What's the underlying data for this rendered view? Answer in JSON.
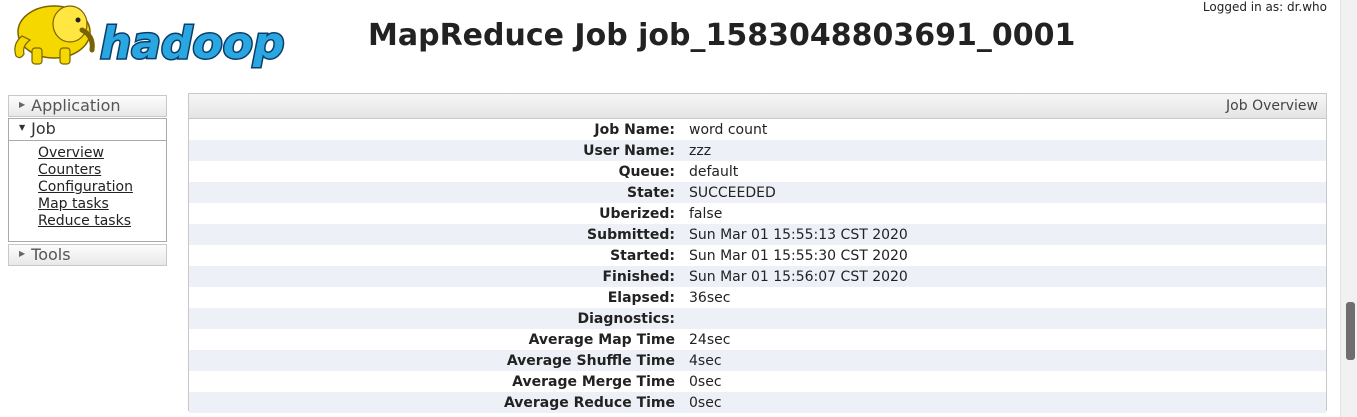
{
  "header": {
    "logo_text": "hadoop",
    "title": "MapReduce Job job_1583048803691_0001",
    "login": "Logged in as: dr.who"
  },
  "nav": {
    "application": "Application",
    "job": "Job",
    "job_links": [
      "Overview",
      "Counters",
      "Configuration",
      "Map tasks",
      "Reduce tasks"
    ],
    "tools": "Tools"
  },
  "overview": {
    "title": "Job Overview",
    "rows": [
      {
        "label": "Job Name:",
        "value": "word count"
      },
      {
        "label": "User Name:",
        "value": "zzz"
      },
      {
        "label": "Queue:",
        "value": "default"
      },
      {
        "label": "State:",
        "value": "SUCCEEDED"
      },
      {
        "label": "Uberized:",
        "value": "false"
      },
      {
        "label": "Submitted:",
        "value": "Sun Mar 01 15:55:13 CST 2020"
      },
      {
        "label": "Started:",
        "value": "Sun Mar 01 15:55:30 CST 2020"
      },
      {
        "label": "Finished:",
        "value": "Sun Mar 01 15:56:07 CST 2020"
      },
      {
        "label": "Elapsed:",
        "value": "36sec"
      },
      {
        "label": "Diagnostics:",
        "value": ""
      },
      {
        "label": "Average Map Time",
        "value": "24sec"
      },
      {
        "label": "Average Shuffle Time",
        "value": "4sec"
      },
      {
        "label": "Average Merge Time",
        "value": "0sec"
      },
      {
        "label": "Average Reduce Time",
        "value": "0sec"
      }
    ]
  },
  "colors": {
    "logo_yellow": "#f5d800",
    "logo_blue": "#2aa7e0",
    "logo_dark": "#0a3d6b"
  }
}
